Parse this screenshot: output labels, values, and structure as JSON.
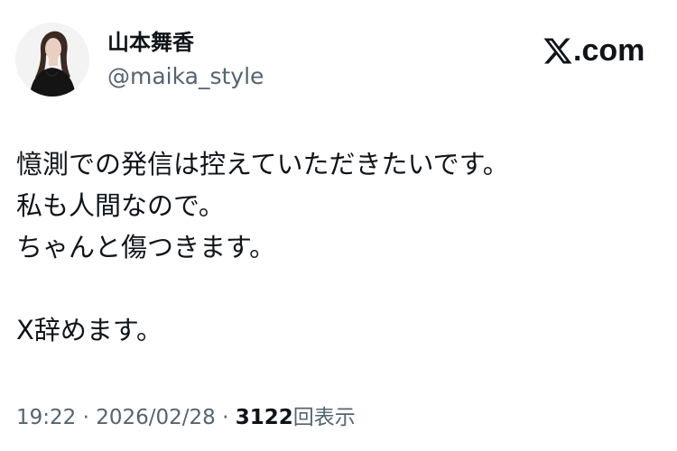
{
  "author": {
    "display_name": "山本舞香",
    "handle": "@maika_style",
    "avatar_icon": "profile-avatar"
  },
  "brand": {
    "icon": "x-logo-icon",
    "label": ".com"
  },
  "tweet": {
    "lines": [
      "憶測での発信は控えていただきたいです。",
      "私も人間なので。",
      "ちゃんと傷つきます。",
      "",
      "X辞めます。"
    ]
  },
  "meta": {
    "time": "19:22",
    "separator": "·",
    "date": "2026/02/28",
    "views_count": "3122",
    "views_label": "回表示"
  },
  "colors": {
    "primary_text": "#0f1419",
    "secondary_text": "#536471",
    "background": "#ffffff"
  }
}
